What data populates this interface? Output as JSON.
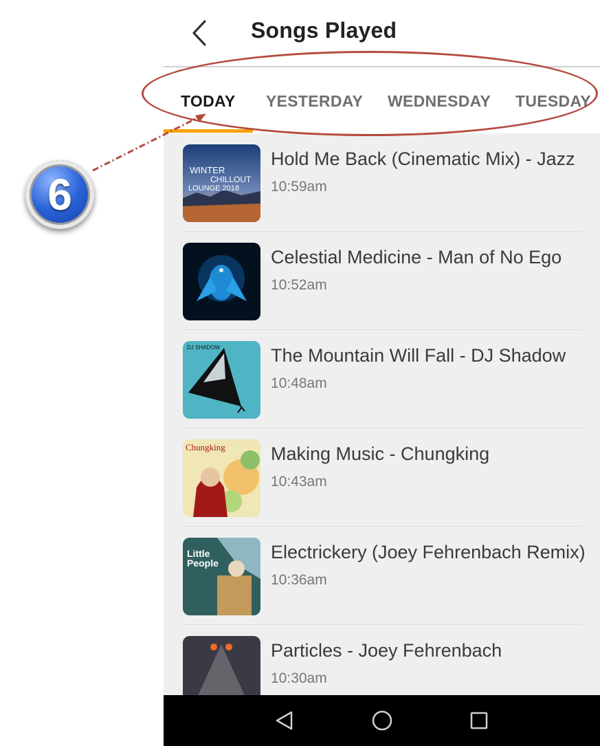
{
  "header": {
    "title": "Songs Played"
  },
  "tabs": [
    {
      "label": "TODAY",
      "active": true
    },
    {
      "label": "YESTERDAY",
      "active": false
    },
    {
      "label": "WEDNESDAY",
      "active": false
    },
    {
      "label": "TUESDAY",
      "active": false
    }
  ],
  "songs": [
    {
      "title": "Hold Me Back (Cinematic Mix) - Jazz",
      "time": "10:59am",
      "art_text": [
        "WINTER",
        "CHILLOUT",
        "LOUNGE 2018"
      ]
    },
    {
      "title": "Celestial Medicine - Man of No Ego",
      "time": "10:52am"
    },
    {
      "title": "The Mountain Will Fall - DJ Shadow",
      "time": "10:48am",
      "art_text": [
        "DJ SHADOW"
      ]
    },
    {
      "title": "Making Music - Chungking",
      "time": "10:43am",
      "art_text": [
        "Chungking"
      ]
    },
    {
      "title": "Electrickery (Joey Fehrenbach Remix)",
      "time": "10:36am",
      "art_text": [
        "Little",
        "People"
      ]
    },
    {
      "title": "Particles - Joey Fehrenbach",
      "time": "10:30am"
    }
  ],
  "callout": {
    "number": "6"
  },
  "colors": {
    "accent": "#f5a300",
    "callout": "#b34a3c",
    "badge": "#2a63d8"
  },
  "icons": [
    "back-arrow-icon",
    "nav-back-icon",
    "nav-home-icon",
    "nav-recents-icon"
  ]
}
